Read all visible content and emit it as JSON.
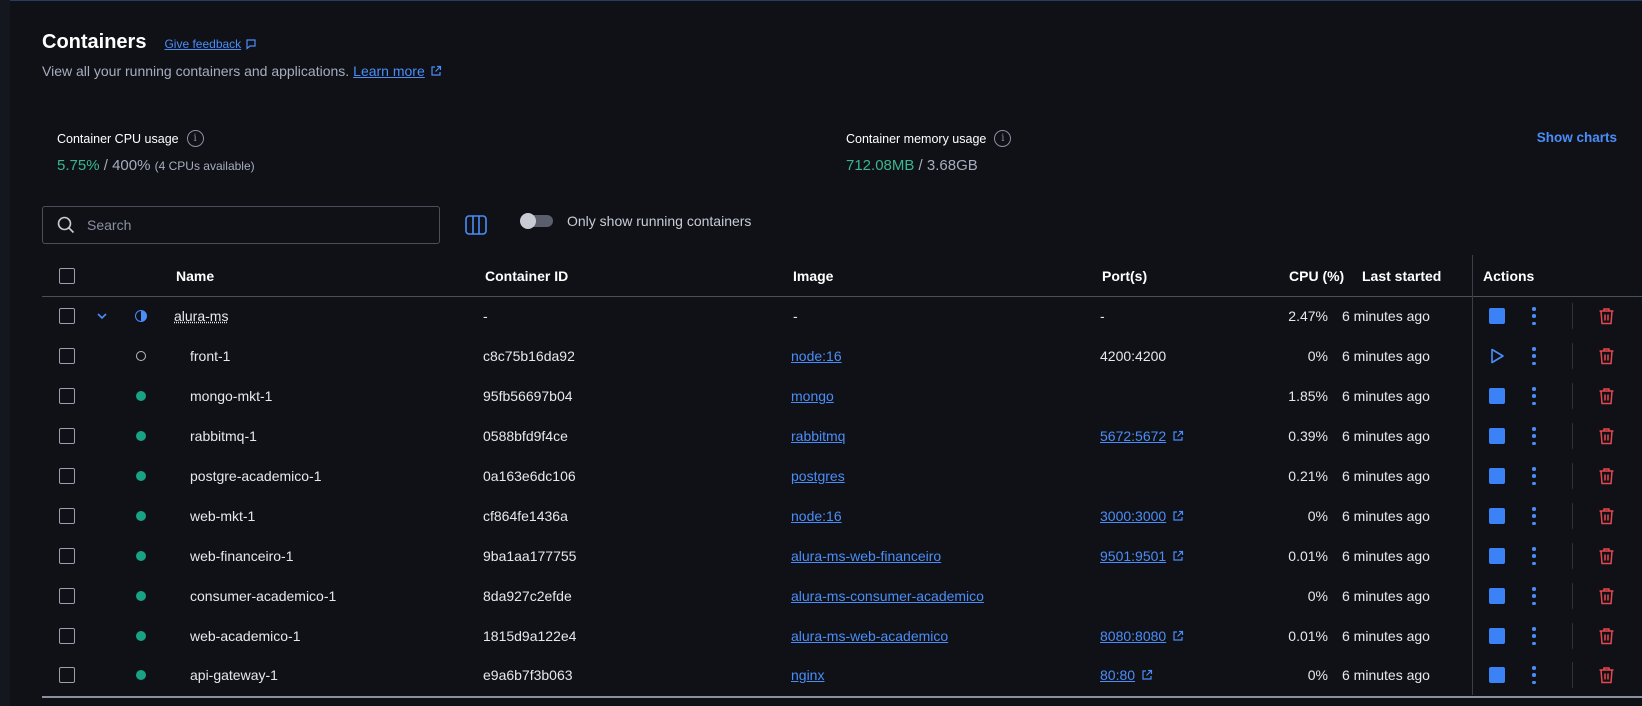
{
  "header": {
    "title": "Containers",
    "feedback_label": "Give feedback",
    "subtitle": "View all your running containers and applications.",
    "learn_more": "Learn more"
  },
  "stats": {
    "cpu": {
      "label": "Container CPU usage",
      "used": "5.75%",
      "sep": " / ",
      "total": "400%",
      "note": "(4 CPUs available)"
    },
    "memory": {
      "label": "Container memory usage",
      "used": "712.08MB",
      "sep": " / ",
      "total": "3.68GB"
    },
    "show_charts": "Show charts"
  },
  "toolbar": {
    "search_placeholder": "Search",
    "toggle_label": "Only show running containers"
  },
  "table": {
    "headers": {
      "name": "Name",
      "container_id": "Container ID",
      "image": "Image",
      "ports": "Port(s)",
      "cpu": "CPU (%)",
      "last_started": "Last started",
      "actions": "Actions"
    },
    "rows": [
      {
        "name": "alura-ms",
        "id": "-",
        "image": "-",
        "ports": "-",
        "cpu": "2.47%",
        "last_started": "6 minutes ago"
      },
      {
        "name": "front-1",
        "id": "c8c75b16da92",
        "image": "node:16",
        "ports": "4200:4200",
        "cpu": "0%",
        "last_started": "6 minutes ago"
      },
      {
        "name": "mongo-mkt-1",
        "id": "95fb56697b04",
        "image": "mongo",
        "ports": "",
        "cpu": "1.85%",
        "last_started": "6 minutes ago"
      },
      {
        "name": "rabbitmq-1",
        "id": "0588bfd9f4ce",
        "image": "rabbitmq",
        "ports": "5672:5672",
        "cpu": "0.39%",
        "last_started": "6 minutes ago"
      },
      {
        "name": "postgre-academico-1",
        "id": "0a163e6dc106",
        "image": "postgres",
        "ports": "",
        "cpu": "0.21%",
        "last_started": "6 minutes ago"
      },
      {
        "name": "web-mkt-1",
        "id": "cf864fe1436a",
        "image": "node:16",
        "ports": "3000:3000",
        "cpu": "0%",
        "last_started": "6 minutes ago"
      },
      {
        "name": "web-financeiro-1",
        "id": "9ba1aa177755",
        "image": "alura-ms-web-financeiro",
        "ports": "9501:9501",
        "cpu": "0.01%",
        "last_started": "6 minutes ago"
      },
      {
        "name": "consumer-academico-1",
        "id": "8da927c2efde",
        "image": "alura-ms-consumer-academico",
        "ports": "",
        "cpu": "0%",
        "last_started": "6 minutes ago"
      },
      {
        "name": "web-academico-1",
        "id": "1815d9a122e4",
        "image": "alura-ms-web-academico",
        "ports": "8080:8080",
        "cpu": "0.01%",
        "last_started": "6 minutes ago"
      },
      {
        "name": "api-gateway-1",
        "id": "e9a6b7f3b063",
        "image": "nginx",
        "ports": "80:80",
        "cpu": "0%",
        "last_started": "6 minutes ago"
      }
    ]
  }
}
